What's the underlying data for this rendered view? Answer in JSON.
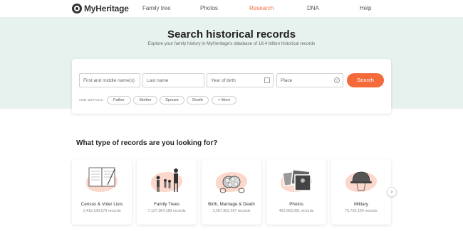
{
  "nav": {
    "logo_text": "MyHeritage",
    "links": [
      "Family tree",
      "Photos",
      "Research",
      "DNA",
      "Help"
    ],
    "active": "Research",
    "accent_color": "#f26d3d"
  },
  "hero": {
    "title": "Search historical records",
    "subtitle": "Explore your family history in MyHeritage's database of 18.4 billion historical records"
  },
  "search_form": {
    "fields": {
      "first_name": "First and middle name(s)",
      "last_name": "Last name",
      "year_of_birth": "Year of birth",
      "place": "Place"
    },
    "search_label": "Search",
    "add_details_label": "ADD DETAILS",
    "pills": [
      "Father",
      "Mother",
      "Spouse",
      "Death",
      "+ More"
    ]
  },
  "section": {
    "title": "What type of records are you looking for?"
  },
  "records": [
    {
      "name": "Census & Voter Lists",
      "count": "1,419,199,573 records",
      "icon": "census-book-icon"
    },
    {
      "name": "Family Trees",
      "count": "7,127,364,189 records",
      "icon": "family-icon"
    },
    {
      "name": "Birth, Marriage & Death",
      "count": "3,287,952,267 records",
      "icon": "rings-flowers-icon"
    },
    {
      "name": "Photos",
      "count": "462,663,291 records",
      "icon": "photos-icon"
    },
    {
      "name": "Military",
      "count": "72,729,166 records",
      "icon": "helmet-icon"
    }
  ],
  "next_symbol": "›"
}
